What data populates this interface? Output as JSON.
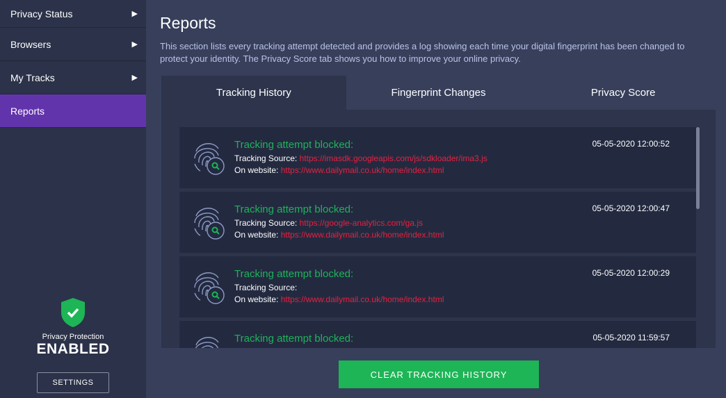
{
  "sidebar": {
    "items": [
      {
        "label": "Privacy Status"
      },
      {
        "label": "Browsers"
      },
      {
        "label": "My Tracks"
      },
      {
        "label": "Reports"
      }
    ],
    "protection_label": "Privacy Protection",
    "protection_status": "ENABLED",
    "settings_label": "SETTINGS"
  },
  "main": {
    "title": "Reports",
    "description": "This section lists every tracking attempt detected and provides a log showing each time your digital fingerprint has been changed to protect your identity. The Privacy Score tab shows you how to improve your online privacy.",
    "tabs": [
      {
        "label": "Tracking History"
      },
      {
        "label": "Fingerprint Changes"
      },
      {
        "label": "Privacy Score"
      }
    ],
    "source_label": "Tracking Source:",
    "website_label": "On website:",
    "entries": [
      {
        "title": "Tracking attempt blocked:",
        "source": "https://imasdk.googleapis.com/js/sdkloader/ima3.js",
        "website": "https://www.dailymail.co.uk/home/index.html",
        "time": "05-05-2020 12:00:52"
      },
      {
        "title": "Tracking attempt blocked:",
        "source": "https://google-analytics.com/ga.js",
        "website": "https://www.dailymail.co.uk/home/index.html",
        "time": "05-05-2020 12:00:47"
      },
      {
        "title": "Tracking attempt blocked:",
        "source": "",
        "website": "https://www.dailymail.co.uk/home/index.html",
        "time": "05-05-2020 12:00:29"
      },
      {
        "title": "Tracking attempt blocked:",
        "time": "05-05-2020 11:59:57"
      }
    ],
    "clear_label": "CLEAR TRACKING HISTORY"
  },
  "colors": {
    "accent": "#6234ac",
    "success": "#1db556",
    "link": "#e8203f"
  }
}
